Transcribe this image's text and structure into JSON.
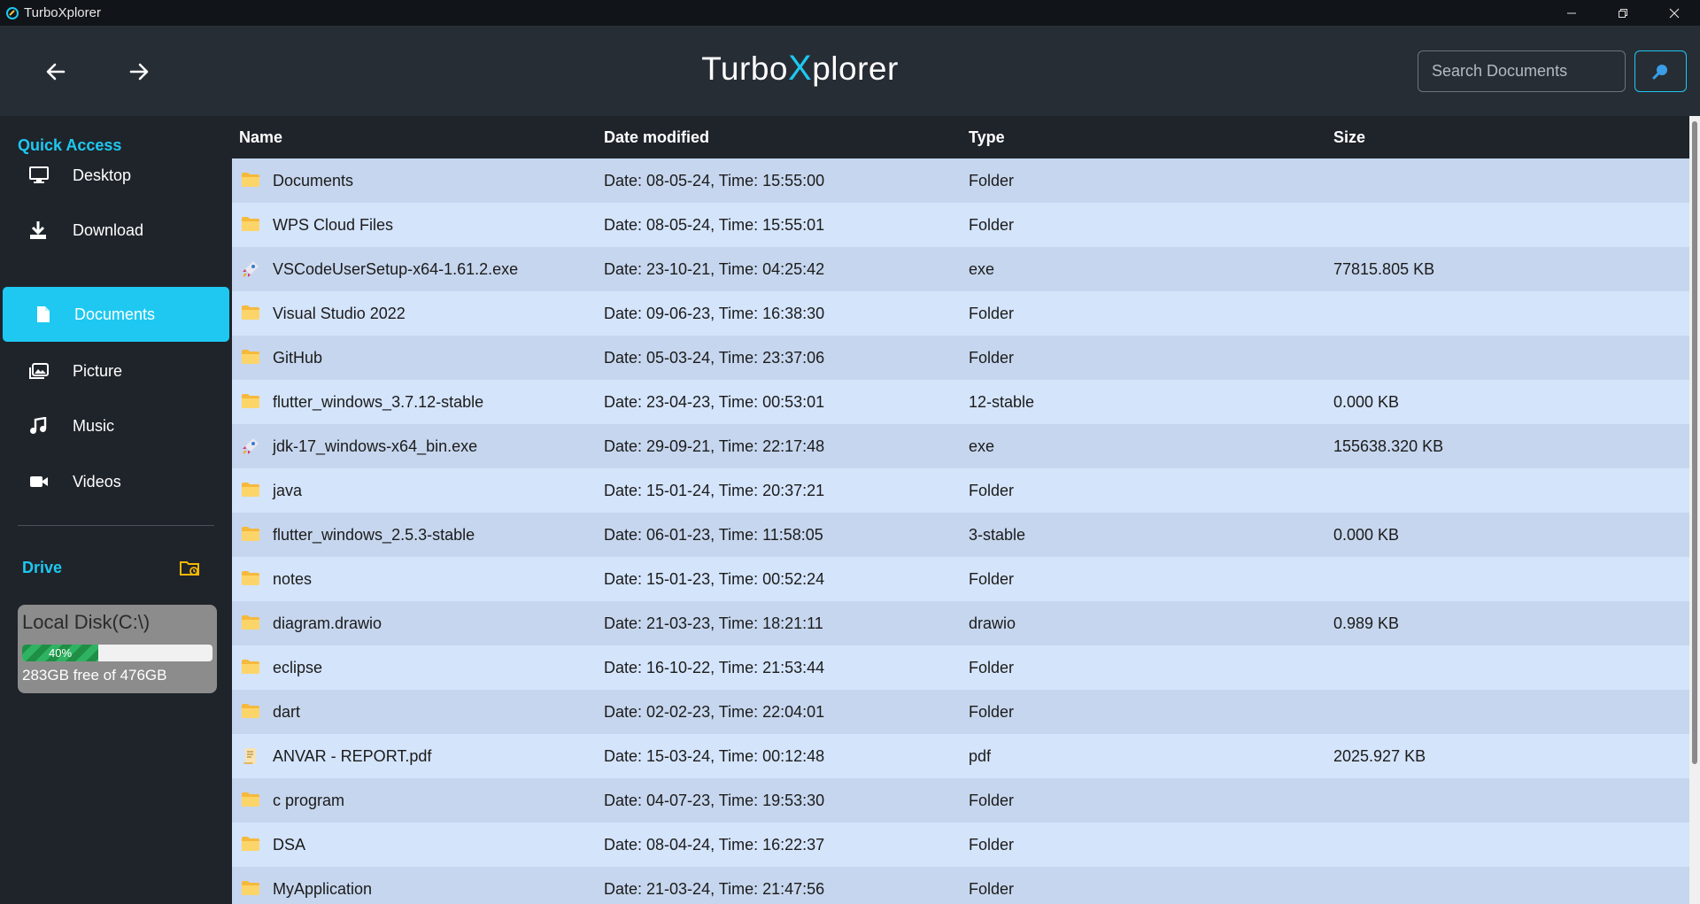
{
  "window": {
    "title": "TurboXplorer"
  },
  "header": {
    "brand_pre": "Turbo",
    "brand_x": "X",
    "brand_post": "plorer",
    "search_placeholder": "Search Documents"
  },
  "sidebar": {
    "quick_access": "Quick Access",
    "items": [
      {
        "label": "Desktop",
        "icon": "monitor-icon"
      },
      {
        "label": "Download",
        "icon": "download-icon"
      },
      {
        "label": "Documents",
        "icon": "document-icon",
        "active": true
      },
      {
        "label": "Picture",
        "icon": "picture-icon"
      },
      {
        "label": "Music",
        "icon": "music-icon"
      },
      {
        "label": "Videos",
        "icon": "video-icon"
      }
    ],
    "drive_title": "Drive",
    "disk": {
      "name": "Local Disk(C:\\)",
      "used_percent": 40,
      "used_label": "40%",
      "free_text": "283GB free of 476GB"
    }
  },
  "table": {
    "columns": [
      "Name",
      "Date modified",
      "Type",
      "Size"
    ],
    "rows": [
      {
        "icon": "folder",
        "name": "Documents",
        "date": "Date: 08-05-24, Time: 15:55:00",
        "type": "Folder",
        "size": ""
      },
      {
        "icon": "folder",
        "name": "WPS Cloud Files",
        "date": "Date: 08-05-24, Time: 15:55:01",
        "type": "Folder",
        "size": ""
      },
      {
        "icon": "exe",
        "name": "VSCodeUserSetup-x64-1.61.2.exe",
        "date": "Date: 23-10-21, Time: 04:25:42",
        "type": "exe",
        "size": "77815.805 KB"
      },
      {
        "icon": "folder",
        "name": "Visual Studio 2022",
        "date": "Date: 09-06-23, Time: 16:38:30",
        "type": "Folder",
        "size": ""
      },
      {
        "icon": "folder",
        "name": "GitHub",
        "date": "Date: 05-03-24, Time: 23:37:06",
        "type": "Folder",
        "size": ""
      },
      {
        "icon": "folder",
        "name": "flutter_windows_3.7.12-stable",
        "date": "Date: 23-04-23, Time: 00:53:01",
        "type": "12-stable",
        "size": "0.000 KB"
      },
      {
        "icon": "exe",
        "name": "jdk-17_windows-x64_bin.exe",
        "date": "Date: 29-09-21, Time: 22:17:48",
        "type": "exe",
        "size": "155638.320 KB"
      },
      {
        "icon": "folder",
        "name": "java",
        "date": "Date: 15-01-24, Time: 20:37:21",
        "type": "Folder",
        "size": ""
      },
      {
        "icon": "folder",
        "name": "flutter_windows_2.5.3-stable",
        "date": "Date: 06-01-23, Time: 11:58:05",
        "type": "3-stable",
        "size": "0.000 KB"
      },
      {
        "icon": "folder",
        "name": "notes",
        "date": "Date: 15-01-23, Time: 00:52:24",
        "type": "Folder",
        "size": ""
      },
      {
        "icon": "folder",
        "name": "diagram.drawio",
        "date": "Date: 21-03-23, Time: 18:21:11",
        "type": "drawio",
        "size": "0.989 KB"
      },
      {
        "icon": "folder",
        "name": "eclipse",
        "date": "Date: 16-10-22, Time: 21:53:44",
        "type": "Folder",
        "size": ""
      },
      {
        "icon": "folder",
        "name": "dart",
        "date": "Date: 02-02-23, Time: 22:04:01",
        "type": "Folder",
        "size": ""
      },
      {
        "icon": "pdf",
        "name": "ANVAR - REPORT.pdf",
        "date": "Date: 15-03-24, Time: 00:12:48",
        "type": "pdf",
        "size": "2025.927 KB"
      },
      {
        "icon": "folder",
        "name": "c program",
        "date": "Date: 04-07-23, Time: 19:53:30",
        "type": "Folder",
        "size": ""
      },
      {
        "icon": "folder",
        "name": "DSA",
        "date": "Date: 08-04-24, Time: 16:22:37",
        "type": "Folder",
        "size": ""
      },
      {
        "icon": "folder",
        "name": "MyApplication",
        "date": "Date: 21-03-24, Time: 21:47:56",
        "type": "Folder",
        "size": ""
      }
    ]
  },
  "colors": {
    "accent": "#1ec8f0",
    "row_odd": "#c6d6ee",
    "row_even": "#d4e4fb",
    "progress": "#2fb363"
  }
}
